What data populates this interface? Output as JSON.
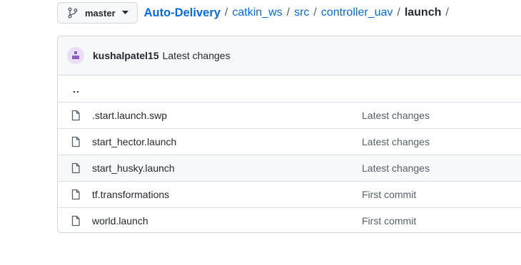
{
  "branch": {
    "label": "master",
    "icon": "git-branch-icon",
    "caret_icon": "triangle-down-icon"
  },
  "breadcrumb": {
    "repo": "Auto-Delivery",
    "separator": "/",
    "parts": [
      "catkin_ws",
      "src",
      "controller_uav"
    ],
    "current": "launch"
  },
  "commit": {
    "author": "kushalpatel15",
    "message": "Latest changes",
    "avatar_color": "#8c5cc9"
  },
  "parent_dir": "..",
  "files": [
    {
      "name": ".start.launch.swp",
      "commit": "Latest changes",
      "icon": "file-icon"
    },
    {
      "name": "start_hector.launch",
      "commit": "Latest changes",
      "icon": "file-icon"
    },
    {
      "name": "start_husky.launch",
      "commit": "Latest changes",
      "icon": "file-icon"
    },
    {
      "name": "tf.transformations",
      "commit": "First commit",
      "icon": "file-icon"
    },
    {
      "name": "world.launch",
      "commit": "First commit",
      "icon": "file-icon"
    }
  ],
  "colors": {
    "link": "#0969da",
    "border": "#d0d7de",
    "header_bg": "#f6f8fa",
    "muted_text": "#57606a"
  }
}
